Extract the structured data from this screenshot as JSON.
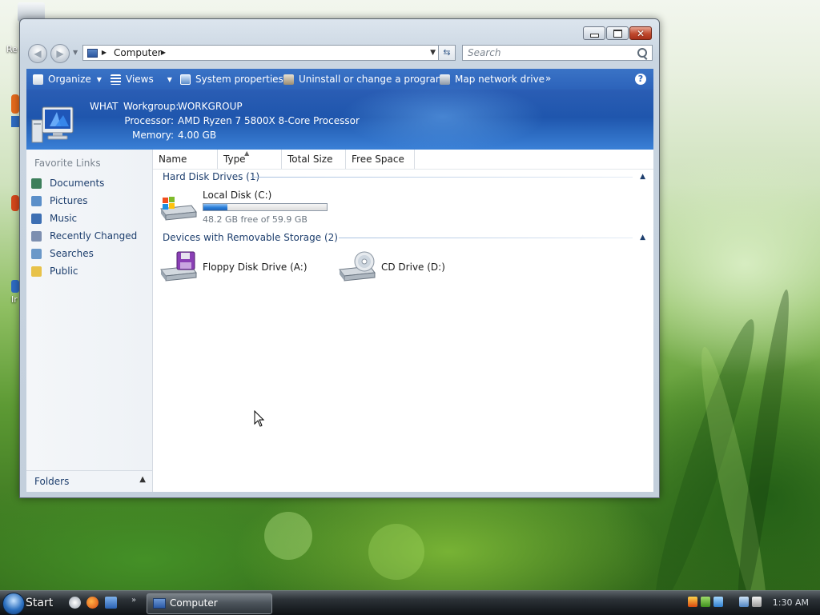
{
  "desktop": {
    "icons": [
      "Re",
      "Ir"
    ]
  },
  "window": {
    "nav": {
      "address_path": "Computer",
      "search_placeholder": "Search"
    },
    "command_bar": {
      "organize": "Organize",
      "views": "Views",
      "system_properties": "System properties",
      "uninstall": "Uninstall or change a program",
      "map_network": "Map network drive",
      "more": "»",
      "help": "?"
    },
    "details": {
      "computer_name": "WHAT",
      "workgroup_label": "Workgroup:",
      "workgroup_value": "WORKGROUP",
      "processor_label": "Processor:",
      "processor_value": "AMD Ryzen 7 5800X 8-Core Processor",
      "memory_label": "Memory:",
      "memory_value": "4.00 GB"
    },
    "nav_pane": {
      "title": "Favorite Links",
      "items": [
        {
          "label": "Documents",
          "icon": "documents-icon",
          "color": "#3d7f5b"
        },
        {
          "label": "Pictures",
          "icon": "pictures-icon",
          "color": "#5b8fc9"
        },
        {
          "label": "Music",
          "icon": "music-icon",
          "color": "#3d6fb3"
        },
        {
          "label": "Recently Changed",
          "icon": "recently-changed-icon",
          "color": "#7d8fb0"
        },
        {
          "label": "Searches",
          "icon": "searches-icon",
          "color": "#6b98c8"
        },
        {
          "label": "Public",
          "icon": "public-folder-icon",
          "color": "#e8c24a"
        }
      ],
      "folders_label": "Folders"
    },
    "main": {
      "columns": [
        "Name",
        "Type",
        "Total Size",
        "Free Space"
      ],
      "groups": {
        "hard_disks": {
          "title": "Hard Disk Drives (1)",
          "drives": [
            {
              "name": "Local Disk (C:)",
              "free_text": "48.2 GB free of 59.9 GB",
              "used_fraction": 0.195
            }
          ]
        },
        "removable": {
          "title": "Devices with Removable Storage (2)",
          "drives": [
            {
              "name": "Floppy Disk Drive (A:)",
              "icon": "floppy-drive-icon"
            },
            {
              "name": "CD Drive (D:)",
              "icon": "cd-drive-icon"
            }
          ]
        }
      }
    }
  },
  "taskbar": {
    "start_label": "Start",
    "task_label": "Computer",
    "clock": "1:30 AM"
  },
  "colors": {
    "accent_blue": "#2d64bb",
    "group_text": "#1e3f6e",
    "close_red": "#c0492d"
  }
}
